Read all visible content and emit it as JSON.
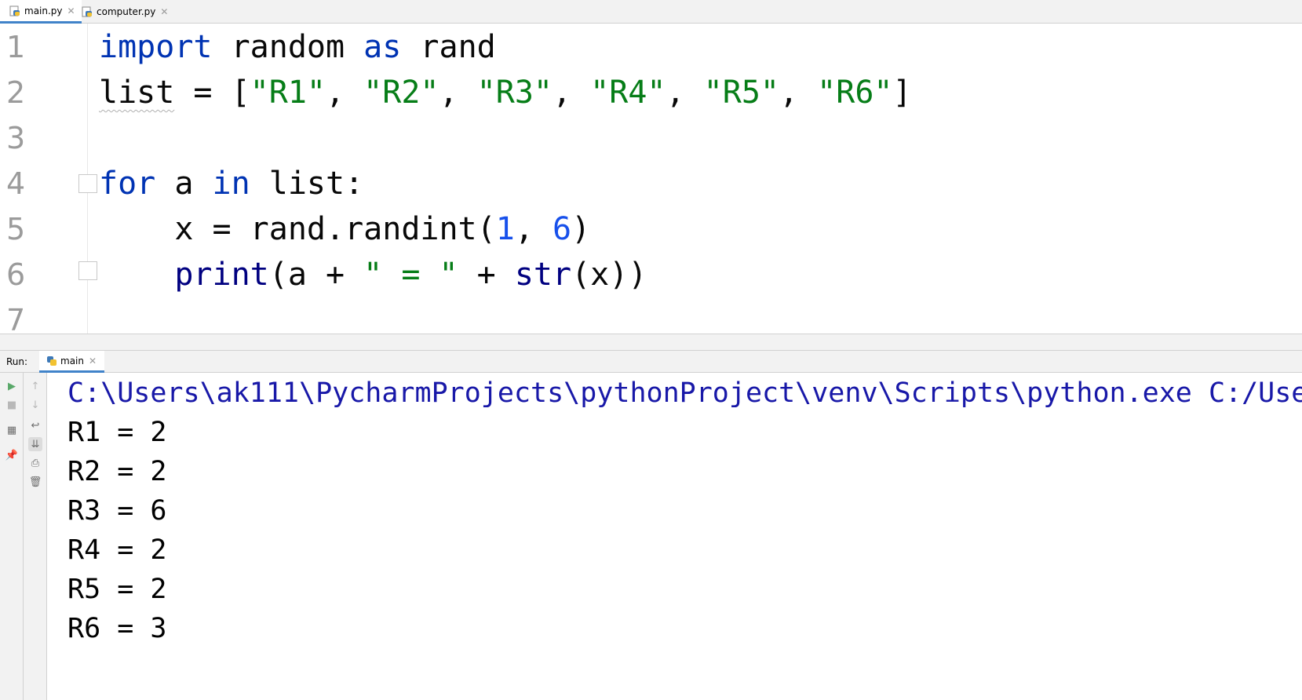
{
  "tabs": [
    {
      "label": "main.py",
      "active": true
    },
    {
      "label": "computer.py",
      "active": false
    }
  ],
  "editor": {
    "line_numbers": [
      "1",
      "2",
      "3",
      "4",
      "5",
      "6",
      "7"
    ],
    "line1": {
      "kw_import": "import",
      "t1": " random ",
      "kw_as": "as",
      "t2": " rand"
    },
    "line2": {
      "var": "list",
      "t1": " = [",
      "s1": "\"R1\"",
      "s2": "\"R2\"",
      "s3": "\"R3\"",
      "s4": "\"R4\"",
      "s5": "\"R5\"",
      "s6": "\"R6\"",
      "sep": ", ",
      "end": "]"
    },
    "line4": {
      "kw_for": "for",
      "t1": " a ",
      "kw_in": "in",
      "t2": " list:"
    },
    "line5": {
      "indent": "    ",
      "t1": "x = rand.randint(",
      "n1": "1",
      "t2": ", ",
      "n2": "6",
      "t3": ")"
    },
    "line6": {
      "indent": "    ",
      "fn_print": "print",
      "t1": "(a + ",
      "s1": "\" = \"",
      "t2": " + ",
      "fn_str": "str",
      "t3": "(x))"
    }
  },
  "run_panel": {
    "label": "Run:",
    "tab_label": "main",
    "command": "C:\\Users\\ak111\\PycharmProjects\\pythonProject\\venv\\Scripts\\python.exe C:/Use",
    "output": [
      "R1 = 2",
      "R2 = 2",
      "R3 = 6",
      "R4 = 2",
      "R5 = 2",
      "R6 = 3"
    ]
  },
  "toolbar_icons": {
    "left": [
      "run-icon",
      "stop-icon",
      "layout-icon",
      "pin-icon"
    ],
    "right": [
      "up-arrow-icon",
      "down-arrow-icon",
      "soft-wrap-icon",
      "scroll-to-end-icon",
      "print-icon",
      "trash-icon"
    ]
  }
}
